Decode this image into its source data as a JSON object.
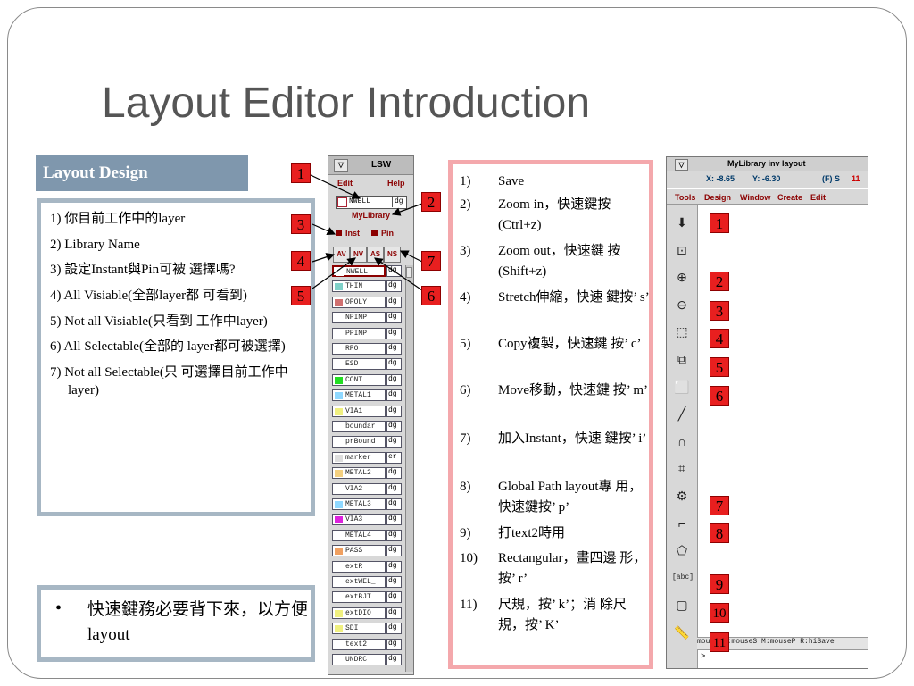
{
  "slide": {
    "title": "Layout Editor Introduction",
    "subhead": "Layout Design"
  },
  "left_notes": [
    "1) 你目前工作中的layer",
    "2) Library Name",
    "3) 設定Instant與Pin可被 選擇嗎?",
    "4) All Visiable(全部layer都 可看到)",
    "5) Not all Visiable(只看到 工作中layer)",
    "6) All Selectable(全部的 layer都可被選擇)",
    "7) Not all Selectable(只 可選擇目前工作中layer)"
  ],
  "bullet_note": {
    "bullet": "•",
    "text": "快速鍵務必要背下來，以方便layout"
  },
  "shortcuts": [
    {
      "num": "1)",
      "text": "Save"
    },
    {
      "num": "2)",
      "text": "Zoom in，快速鍵按 (Ctrl+z)"
    },
    {
      "num": "3)",
      "text": "Zoom out，快速鍵 按(Shift+z)"
    },
    {
      "num": "4)",
      "text": "Stretch伸縮，快速 鍵按’ s’"
    },
    {
      "num": "5)",
      "text": "Copy複製，快速鍵 按’ c’"
    },
    {
      "num": "6)",
      "text": "Move移動，快速鍵 按’ m’"
    },
    {
      "num": "7)",
      "text": "加入Instant，快速 鍵按’ i’"
    },
    {
      "num": "8)",
      "text": "Global Path layout專 用，快速鍵按’ p’"
    },
    {
      "num": "9)",
      "text": "打text2時用"
    },
    {
      "num": "10)",
      "text": "Rectangular，畫四邊 形，按’ r’"
    },
    {
      "num": "11)",
      "text": "尺規，按’ k’；消 除尺規，按’ K’"
    }
  ],
  "badges_left": [
    "1",
    "2",
    "3",
    "4",
    "5",
    "6",
    "7"
  ],
  "badges_right": [
    "1",
    "2",
    "3",
    "4",
    "5",
    "6",
    "7",
    "8",
    "9",
    "10",
    "11"
  ],
  "lsw": {
    "title": "LSW",
    "menu_edit": "Edit",
    "menu_help": "Help",
    "current_layer": "NWELL",
    "current_purpose": "dg",
    "library": "MyLibrary",
    "inst_label": "Inst",
    "pin_label": "Pin",
    "btn_av": "AV",
    "btn_nv": "NV",
    "btn_as": "AS",
    "btn_ns": "NS",
    "layers": [
      {
        "name": "NWELL",
        "purpose": "dg",
        "color": "#ffffff"
      },
      {
        "name": "THIN",
        "purpose": "dg",
        "color": "#7fd0c8"
      },
      {
        "name": "OPOLY",
        "purpose": "dg",
        "color": "#d07070"
      },
      {
        "name": "NPIMP",
        "purpose": "dg",
        "color": "#ffffff"
      },
      {
        "name": "PPIMP",
        "purpose": "dg",
        "color": "#ffffff"
      },
      {
        "name": "RPO",
        "purpose": "dg",
        "color": "#ffffff"
      },
      {
        "name": "ESD",
        "purpose": "dg",
        "color": "#ffffff"
      },
      {
        "name": "CONT",
        "purpose": "dg",
        "color": "#22dd22"
      },
      {
        "name": "METAL1",
        "purpose": "dg",
        "color": "#8fd8ff"
      },
      {
        "name": "VIA1",
        "purpose": "dg",
        "color": "#f0f080"
      },
      {
        "name": "boundar",
        "purpose": "dg",
        "color": "#ffffff"
      },
      {
        "name": "prBound",
        "purpose": "dg",
        "color": "#ffffff"
      },
      {
        "name": "marker",
        "purpose": "er",
        "color": "#dddddd"
      },
      {
        "name": "METAL2",
        "purpose": "dg",
        "color": "#f4d080"
      },
      {
        "name": "VIA2",
        "purpose": "dg",
        "color": "#ffffff"
      },
      {
        "name": "METAL3",
        "purpose": "dg",
        "color": "#8fd8ff"
      },
      {
        "name": "VIA3",
        "purpose": "dg",
        "color": "#dd22dd"
      },
      {
        "name": "METAL4",
        "purpose": "dg",
        "color": "#ffffff"
      },
      {
        "name": "PASS",
        "purpose": "dg",
        "color": "#f0a060"
      },
      {
        "name": "extR",
        "purpose": "dg",
        "color": "#ffffff"
      },
      {
        "name": "extWEL_",
        "purpose": "dg",
        "color": "#ffffff"
      },
      {
        "name": "extBJT",
        "purpose": "dg",
        "color": "#ffffff"
      },
      {
        "name": "extDIO",
        "purpose": "dg",
        "color": "#f0f080"
      },
      {
        "name": "SDI",
        "purpose": "dg",
        "color": "#f0f080"
      },
      {
        "name": "text2",
        "purpose": "dg",
        "color": "#ffffff"
      },
      {
        "name": "UNDRC",
        "purpose": "dg",
        "color": "#ffffff"
      }
    ]
  },
  "layout_window": {
    "title": "MyLibrary inv layout",
    "x_label": "X: -8.65",
    "y_label": "Y: -6.30",
    "fs_label": "(F) S",
    "count": "11",
    "menus": [
      "Tools",
      "Design",
      "Window",
      "Create",
      "Edit"
    ],
    "tools": [
      {
        "name": "save-icon",
        "glyph": "⬇"
      },
      {
        "name": "fit-icon",
        "glyph": "⊡"
      },
      {
        "name": "zoom-in-icon",
        "glyph": "⊕"
      },
      {
        "name": "zoom-out-icon",
        "glyph": "⊖"
      },
      {
        "name": "stretch-icon",
        "glyph": "⬚"
      },
      {
        "name": "copy-icon",
        "glyph": "⧉"
      },
      {
        "name": "move-icon",
        "glyph": "⬜"
      },
      {
        "name": "path-icon",
        "glyph": "╱"
      },
      {
        "name": "instance-icon",
        "glyph": "∩"
      },
      {
        "name": "grid-icon",
        "glyph": "⌗"
      },
      {
        "name": "global-path-icon",
        "glyph": "⚙"
      },
      {
        "name": "wire-icon",
        "glyph": "⌐"
      },
      {
        "name": "polygon-icon",
        "glyph": "⬠"
      },
      {
        "name": "label-icon",
        "glyph": "[abc]"
      },
      {
        "name": "rectangle-icon",
        "glyph": "▢"
      },
      {
        "name": "ruler-icon",
        "glyph": "📏"
      }
    ],
    "status": "mouse L:mouseS M:mouseP R:hiSave",
    "prompt": ">"
  }
}
